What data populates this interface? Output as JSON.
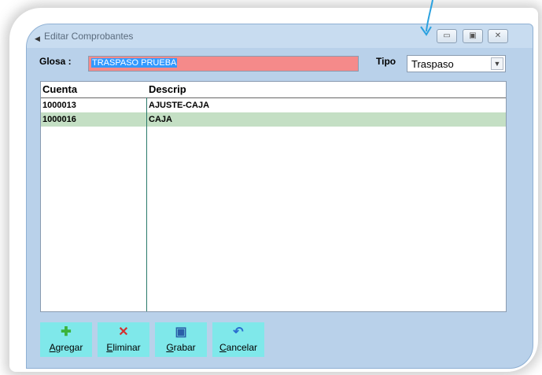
{
  "window": {
    "title": "Editar Comprobantes"
  },
  "glosa": {
    "label": "Glosa :",
    "value": "TRASPASO PRUEBA"
  },
  "tipo": {
    "label": "Tipo",
    "selected": "Traspaso"
  },
  "grid": {
    "columns": [
      "Cuenta",
      "Descrip"
    ],
    "rows": [
      {
        "cuenta": "1000013",
        "descrip": "AJUSTE-CAJA"
      },
      {
        "cuenta": "1000016",
        "descrip": "CAJA"
      }
    ]
  },
  "buttons": {
    "agregar": {
      "mnemonic": "A",
      "rest": "gregar",
      "icon": "add-icon"
    },
    "eliminar": {
      "mnemonic": "E",
      "rest": "liminar",
      "icon": "delete-icon"
    },
    "grabar": {
      "mnemonic": "G",
      "rest": "rabar",
      "icon": "save-icon"
    },
    "cancelar": {
      "mnemonic": "C",
      "rest": "ancelar",
      "icon": "undo-icon"
    }
  },
  "colors": {
    "window_bg": "#b9d1ea",
    "glosa_bg": "#f58a8a",
    "selected_row": "#c4dfc4",
    "button_bg": "#7fe8ea",
    "arrow": "#2aa1df"
  }
}
